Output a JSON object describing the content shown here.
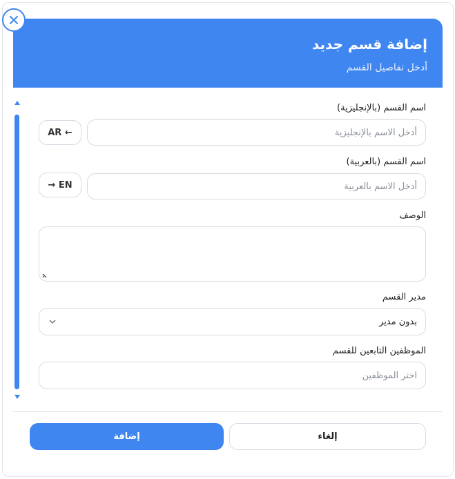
{
  "dialog": {
    "title": "إضافة قسم جديد",
    "subtitle": "أدخل تفاصيل القسم",
    "accent_color": "#3f86f1",
    "close_icon": "close-icon"
  },
  "form": {
    "name_en": {
      "label": "اسم القسم (بالإنجليزية)",
      "placeholder": "أدخل الاسم بالإنجليزية",
      "value": "",
      "translate_button": "AR ←"
    },
    "name_ar": {
      "label": "اسم القسم (بالعربية)",
      "placeholder": "أدخل الاسم بالعربية",
      "value": "",
      "translate_button": "→ EN"
    },
    "description": {
      "label": "الوصف",
      "value": ""
    },
    "manager": {
      "label": "مدير القسم",
      "selected": "بدون مدير"
    },
    "employees": {
      "label": "الموظفين التابعين للقسم",
      "placeholder": "اختر الموظفين"
    }
  },
  "footer": {
    "submit_label": "إضافة",
    "cancel_label": "إلغاء"
  }
}
